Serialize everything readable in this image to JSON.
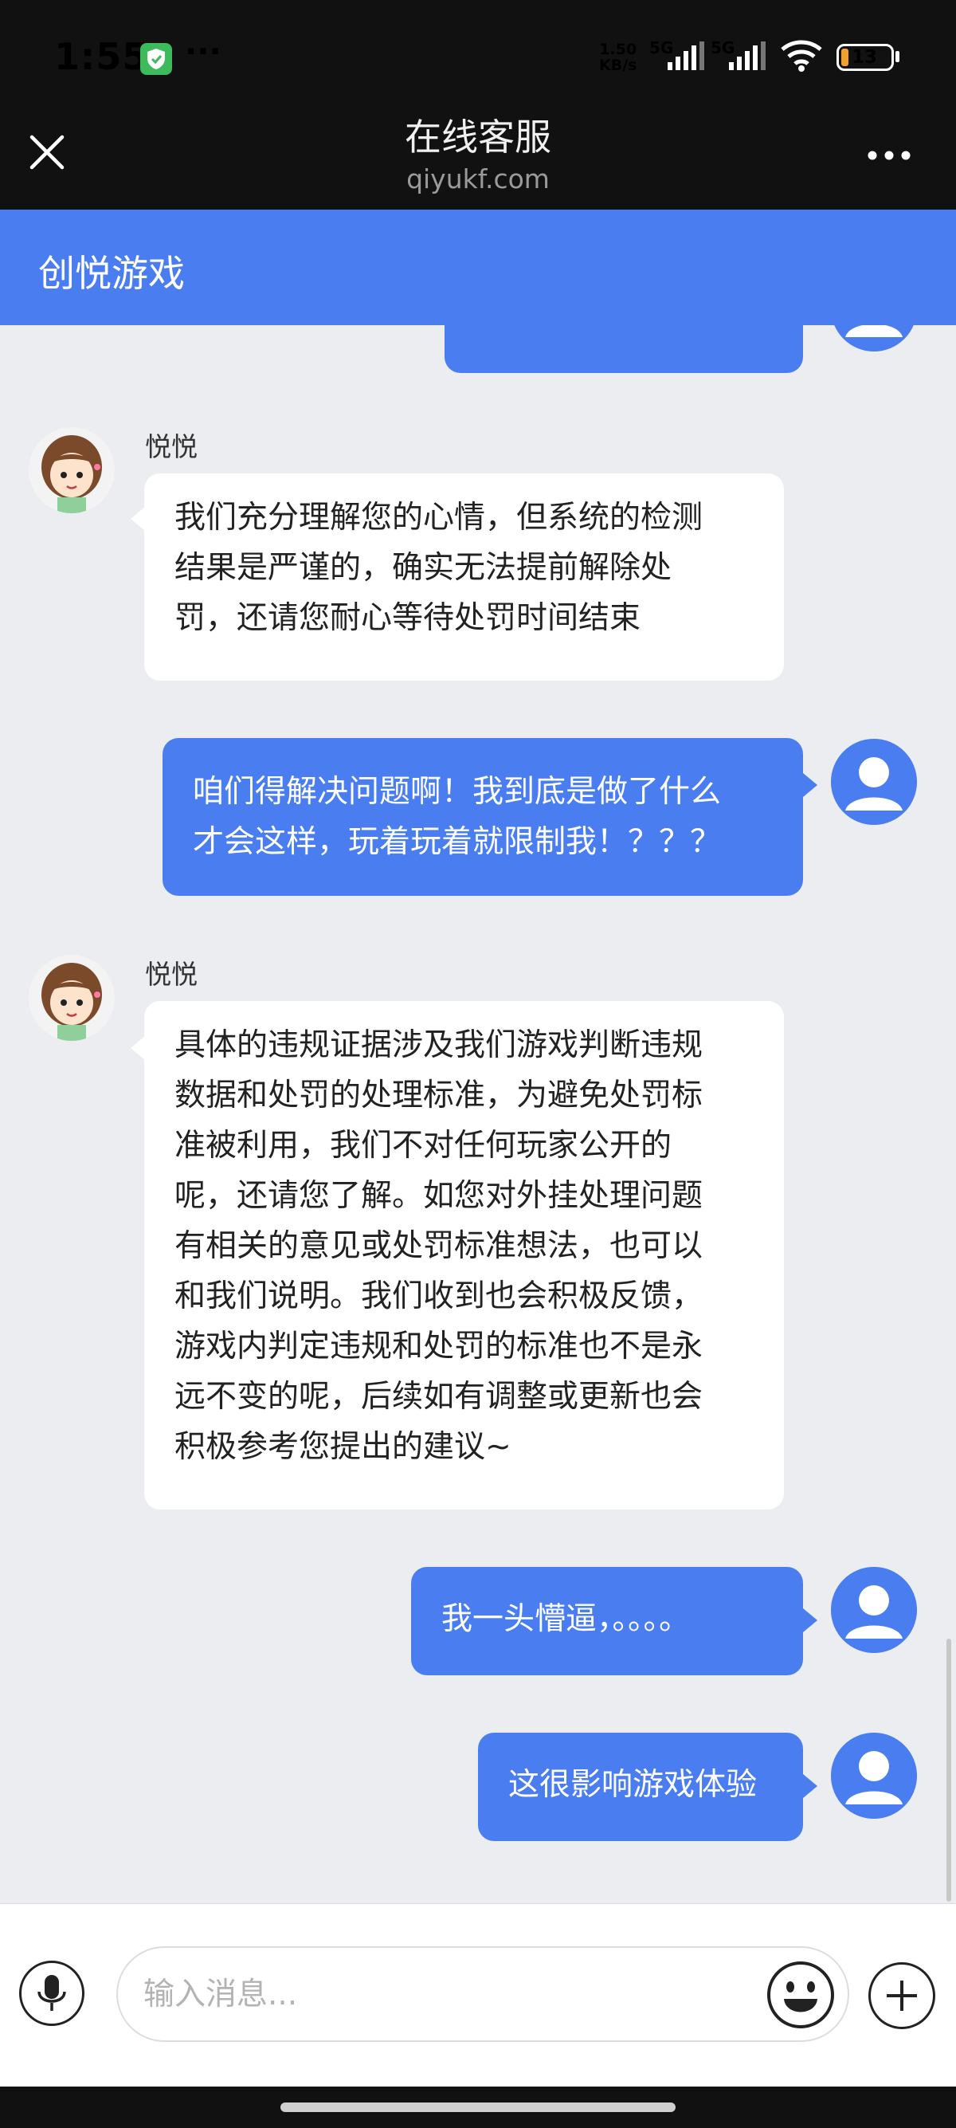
{
  "status_bar": {
    "time": "1:55",
    "more": "···",
    "net_speed": "1.50",
    "net_speed_unit": "KB/s",
    "net_type_1": "5G",
    "net_type_2": "5G",
    "battery": "13"
  },
  "title_bar": {
    "title": "在线客服",
    "subtitle": "qiyukf.com"
  },
  "company": {
    "name": "创悦游戏"
  },
  "chat": {
    "messages": [
      {
        "from": "user",
        "text": "(partially hidden)"
      },
      {
        "from": "agent",
        "name": "悦悦",
        "text": "我们充分理解您的心情，但系统的检测\n结果是严谨的，确实无法提前解除处\n罚，还请您耐心等待处罚时间结束"
      },
      {
        "from": "user",
        "text": "咱们得解决问题啊！我到底是做了什么\n才会这样，玩着玩着就限制我！？？？"
      },
      {
        "from": "agent",
        "name": "悦悦",
        "text": "具体的违规证据涉及我们游戏判断违规\n数据和处罚的处理标准，为避免处罚标\n准被利用，我们不对任何玩家公开的\n呢，还请您了解。如您对外挂处理问题\n有相关的意见或处罚标准想法，也可以\n和我们说明。我们收到也会积极反馈，\n游戏内判定违规和处罚的标准也不是永\n远不变的呢，后续如有调整或更新也会\n积极参考您提出的建议~"
      },
      {
        "from": "user",
        "text": "我一头懵逼，。。。。"
      },
      {
        "from": "user",
        "text": "这很影响游戏体验"
      }
    ]
  },
  "input": {
    "placeholder": "输入消息..."
  },
  "colors": {
    "accent": "#4a7ef0",
    "background": "#ebedf0",
    "bar": "#111111"
  }
}
